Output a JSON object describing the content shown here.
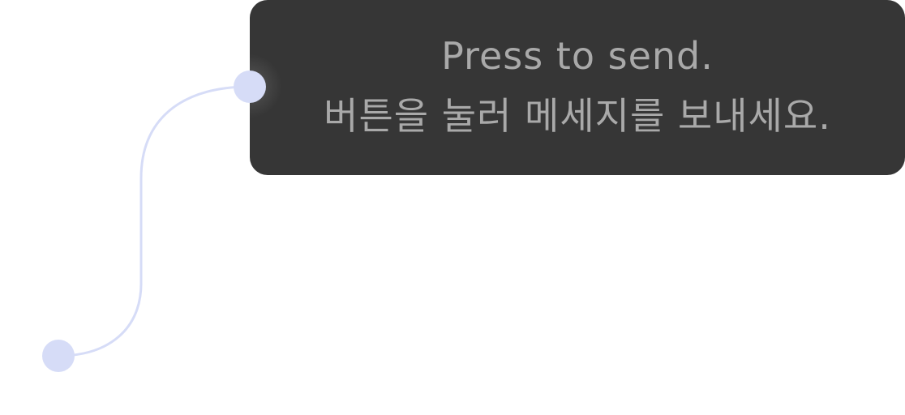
{
  "tooltip": {
    "line1": "Press to send.",
    "line2": "버튼을 눌러 메세지를 보내세요."
  },
  "colors": {
    "tooltip_background": "#363636",
    "tooltip_text": "#a9a9a9",
    "connector": "#d6dcf7",
    "page_background": "#ffffff"
  }
}
